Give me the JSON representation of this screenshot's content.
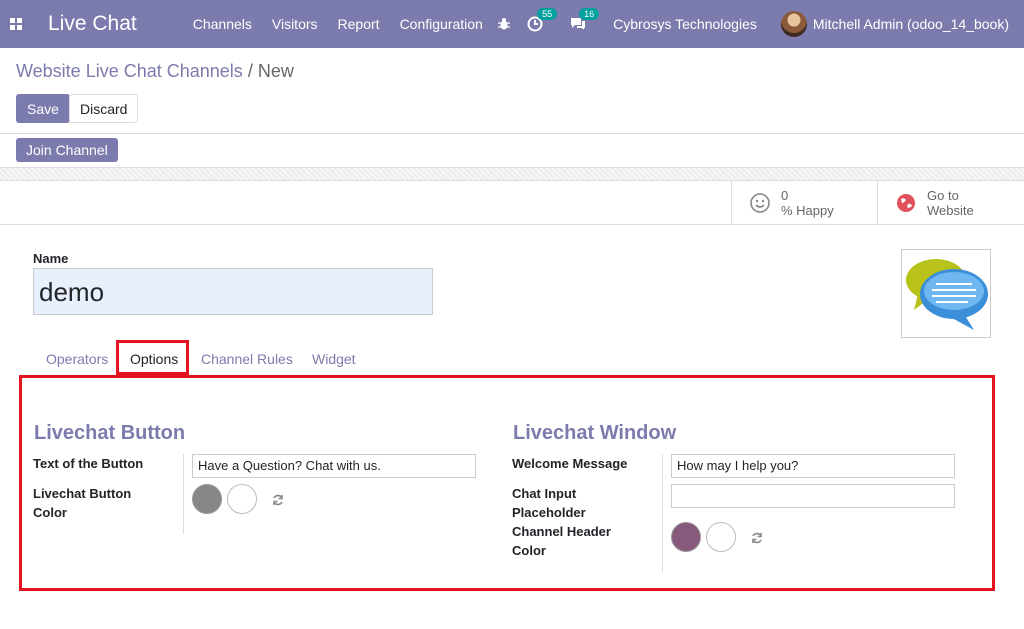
{
  "navbar": {
    "app_name": "Live Chat",
    "menu": [
      "Channels",
      "Visitors",
      "Report",
      "Configuration"
    ],
    "activity_count": "55",
    "message_count": "16",
    "company": "Cybrosys Technologies",
    "user": "Mitchell Admin (odoo_14_book)",
    "color": "#7c7bad"
  },
  "breadcrumb": {
    "parent": "Website Live Chat Channels",
    "separator": "/",
    "current": "New"
  },
  "buttons": {
    "save": "Save",
    "discard": "Discard",
    "join_channel": "Join Channel"
  },
  "stat_buttons": {
    "happy_value": "0",
    "happy_label": "% Happy",
    "website_line1": "Go to",
    "website_line2": "Website"
  },
  "form": {
    "name_label": "Name",
    "name_value": "demo"
  },
  "tabs": [
    "Operators",
    "Options",
    "Channel Rules",
    "Widget"
  ],
  "active_tab": "Options",
  "options": {
    "button_group": {
      "title": "Livechat Button",
      "text_label": "Text of the Button",
      "text_value": "Have a Question? Chat with us.",
      "color_label_1": "Livechat Button",
      "color_label_2": "Color",
      "color": "#878787"
    },
    "window_group": {
      "title": "Livechat Window",
      "welcome_label": "Welcome Message",
      "welcome_value": "How may I help you?",
      "placeholder_label_1": "Chat Input",
      "placeholder_label_2": "Placeholder",
      "placeholder_value": "",
      "header_label_1": "Channel Header",
      "header_label_2": "Color",
      "header_color": "#875a7b"
    }
  }
}
